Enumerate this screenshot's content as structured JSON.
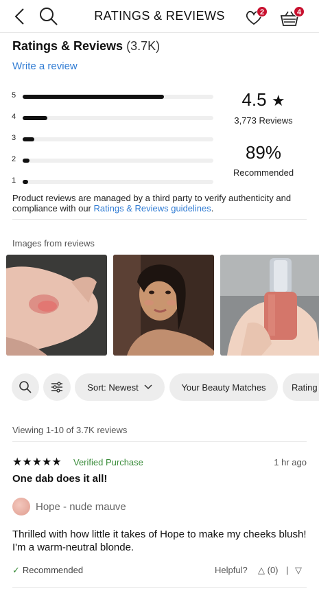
{
  "header": {
    "title": "RATINGS & REVIEWS",
    "loves_badge": "2",
    "basket_badge": "4",
    "accent_color": "#c8102e"
  },
  "summary": {
    "heading": "Ratings & Reviews",
    "count": "(3.7K)",
    "write_link": "Write a review",
    "average": "4.5",
    "star_glyph": "★",
    "reviews_count": "3,773 Reviews",
    "recommended_pct": "89%",
    "recommended_label": "Recommended",
    "link_color": "#2f7bd3"
  },
  "histogram": [
    {
      "label": "5",
      "fraction": 0.74
    },
    {
      "label": "4",
      "fraction": 0.13
    },
    {
      "label": "3",
      "fraction": 0.06
    },
    {
      "label": "2",
      "fraction": 0.035
    },
    {
      "label": "1",
      "fraction": 0.03
    }
  ],
  "disclaimer": {
    "text": "Product reviews are managed by a third party to verify authenticity and compliance with our",
    "link": "Ratings & Reviews guidelines",
    "end": "."
  },
  "images": {
    "label": "Images from reviews",
    "items": [
      "swatch-hand-photo",
      "selfie-photo",
      "product-in-hand-photo"
    ]
  },
  "filters": {
    "search_icon": "search-icon",
    "filter_icon": "sliders-icon",
    "sort": "Sort: Newest",
    "beauty_matches": "Your Beauty Matches",
    "rating": "Rating"
  },
  "viewing": "Viewing 1-10 of 3.7K reviews",
  "review": {
    "stars": "★★★★★",
    "verified": "Verified Purchase",
    "time": "1 hr ago",
    "title": "One dab does it all!",
    "shade": "Hope - nude mauve",
    "body": "Thrilled with how little it takes of Hope to make my cheeks blush! I'm a warm-neutral blonde.",
    "recommended": "Recommended",
    "check": "✓",
    "helpful": "Helpful?",
    "up": "△ (0)",
    "sep": "|",
    "down": "▽",
    "verified_color": "#3a8c3a"
  }
}
